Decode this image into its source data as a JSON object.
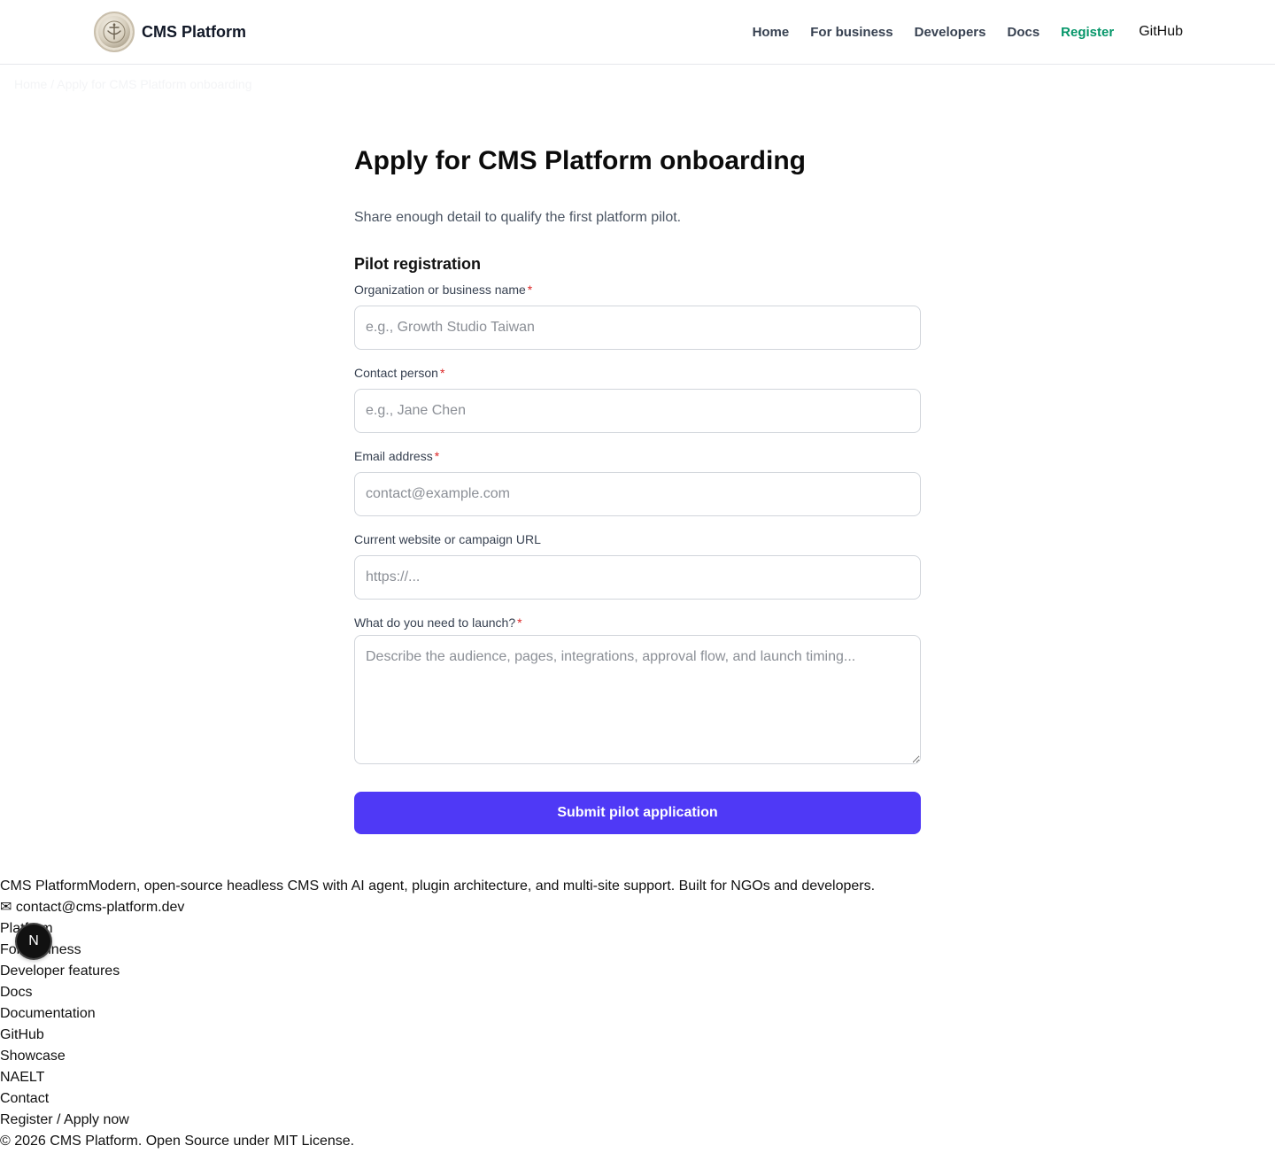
{
  "header": {
    "brand_name": "CMS Platform",
    "logo_icon": "seal-logo-icon",
    "nav": [
      {
        "label": "Home"
      },
      {
        "label": "For business"
      },
      {
        "label": "Developers"
      },
      {
        "label": "Docs"
      },
      {
        "label": "Register",
        "active": true
      },
      {
        "label": "GitHub"
      }
    ],
    "active_color": "#059669"
  },
  "breadcrumb": {
    "home": "Home",
    "separator": "/",
    "current": "Apply for CMS Platform onboarding"
  },
  "main": {
    "title": "Apply for CMS Platform onboarding",
    "subtitle": "Share enough detail to qualify the first platform pilot.",
    "section_title": "Pilot registration",
    "required_marker": "*",
    "fields": {
      "org": {
        "label": "Organization or business name",
        "placeholder": "e.g., Growth Studio Taiwan",
        "value": ""
      },
      "contact": {
        "label": "Contact person",
        "placeholder": "e.g., Jane Chen",
        "value": ""
      },
      "email": {
        "label": "Email address",
        "placeholder": "contact@example.com",
        "value": ""
      },
      "url": {
        "label": "Current website or campaign URL",
        "placeholder": "https://...",
        "value": ""
      },
      "needs": {
        "label": "What do you need to launch?",
        "placeholder": "Describe the audience, pages, integrations, approval flow, and launch timing...",
        "value": ""
      }
    },
    "submit_label": "Submit pilot application",
    "accent_color": "#4f39f6"
  },
  "footer": {
    "brand": "CMS Platform",
    "tagline": "Modern, open-source headless CMS with AI agent, plugin architecture, and multi-site support. Built for NGOs and developers.",
    "email_icon": "✉",
    "email": "contact@cms-platform.dev",
    "links": [
      "Platform",
      "For business",
      "Developer features",
      "Docs",
      "Documentation",
      "GitHub",
      "Showcase",
      "NAELT",
      "Contact",
      "Register / Apply now"
    ],
    "copyright": "© 2026 CMS Platform. Open Source under MIT License."
  },
  "devtools_badge": {
    "label": "N",
    "icon": "nextjs-devtools-icon"
  }
}
